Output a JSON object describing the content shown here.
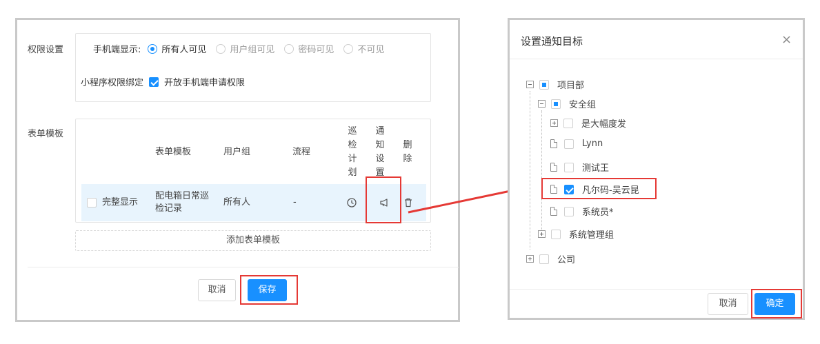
{
  "left": {
    "permission_label": "权限设置",
    "mobile_display_label": "手机端显示:",
    "radios": [
      {
        "label": "所有人可见",
        "checked": true
      },
      {
        "label": "用户组可见",
        "checked": false
      },
      {
        "label": "密码可见",
        "checked": false
      },
      {
        "label": "不可见",
        "checked": false
      }
    ],
    "miniapp_label": "小程序权限绑定",
    "miniapp_checkbox": "开放手机端申请权限",
    "form_template_label": "表单模板",
    "table": {
      "headers": {
        "template": "表单模板",
        "usergroup": "用户组",
        "flow": "流程",
        "patrol": [
          "巡",
          "检",
          "计",
          "划"
        ],
        "notify": [
          "通",
          "知",
          "设",
          "置"
        ],
        "delete": [
          "删",
          "除"
        ]
      },
      "row": {
        "full_display": "完整显示",
        "template_line1": "配电箱日常巡",
        "template_line2": "检记录",
        "usergroup": "所有人",
        "flow": "-"
      }
    },
    "add_template": "添加表单模板",
    "cancel": "取消",
    "save": "保存"
  },
  "dialog": {
    "title": "设置通知目标",
    "close": "×",
    "tree": {
      "root": "项目部",
      "safety": "安全组",
      "n1": "是大幅度发",
      "n2": "Lynn",
      "n3": "测试王",
      "n4": "凡尔码-吴云昆",
      "n5": "系统员*",
      "sysadmin": "系统管理组",
      "company": "公司"
    },
    "cancel": "取消",
    "confirm": "确定"
  },
  "colors": {
    "primary": "#1890ff",
    "highlight": "#e53935",
    "row_bg": "#e8f4fd"
  }
}
